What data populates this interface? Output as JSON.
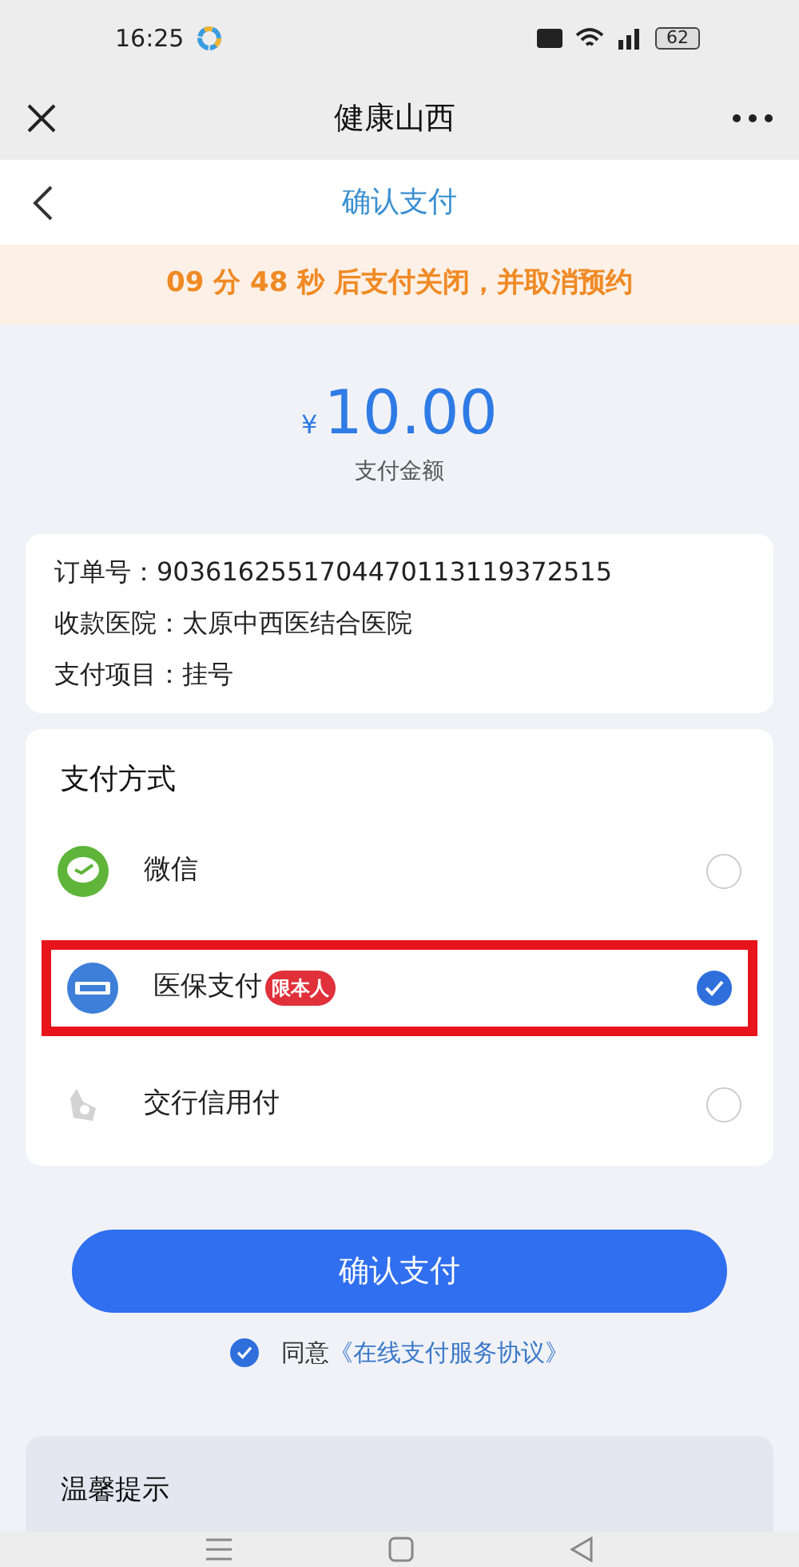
{
  "status_bar": {
    "time": "16:25",
    "battery": "62"
  },
  "title_bar": {
    "title": "健康山西"
  },
  "header": {
    "title": "确认支付"
  },
  "countdown": {
    "text": "09 分 48 秒 后支付关闭，并取消预约"
  },
  "amount": {
    "currency": "¥",
    "value": "10.00",
    "label": "支付金额"
  },
  "order": [
    {
      "label": "订单号：",
      "value": "9036162551704470113119372515"
    },
    {
      "label": "收款医院：",
      "value": "太原中西医结合医院"
    },
    {
      "label": "支付项目：",
      "value": "挂号"
    }
  ],
  "payment": {
    "title": "支付方式",
    "options": [
      {
        "kind": "wechat",
        "label": "微信",
        "selected": false,
        "highlighted": false
      },
      {
        "kind": "chs",
        "label": "医保支付",
        "badge": "限本人",
        "selected": true,
        "highlighted": true
      },
      {
        "kind": "bank",
        "label": "交行信用付",
        "selected": false,
        "highlighted": false
      }
    ]
  },
  "confirm_button": "确认支付",
  "agreement": {
    "checked": true,
    "text": "同意",
    "link": "《在线支付服务协议》"
  },
  "tips": {
    "title": "温馨提示"
  }
}
